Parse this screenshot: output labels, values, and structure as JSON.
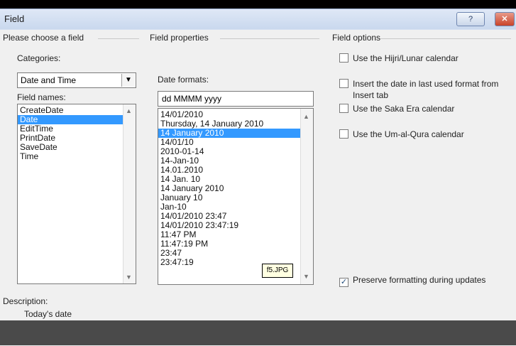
{
  "window": {
    "title": "Field",
    "help_btn": "?",
    "close_btn": "✕"
  },
  "choose": {
    "group_title": "Please choose a field",
    "categories_label": "Categories:",
    "categories_value": "Date and Time",
    "field_names_label": "Field names:",
    "field_names": [
      "CreateDate",
      "Date",
      "EditTime",
      "PrintDate",
      "SaveDate",
      "Time"
    ],
    "selected_field": "Date"
  },
  "properties": {
    "group_title": "Field properties",
    "date_formats_label": "Date formats:",
    "date_format_value": "dd MMMM yyyy",
    "date_formats": [
      "14/01/2010",
      "Thursday, 14 January 2010",
      "14 January 2010",
      "14/01/10",
      "2010-01-14",
      "14-Jan-10",
      "14.01.2010",
      "14 Jan. 10",
      "14 January 2010",
      "January 10",
      "Jan-10",
      "14/01/2010 23:47",
      "14/01/2010 23:47:19",
      "11:47 PM",
      "11:47:19 PM",
      "23:47",
      "23:47:19"
    ],
    "selected_format_index": 2
  },
  "options": {
    "group_title": "Field options",
    "hijri": "Use the Hijri/Lunar calendar",
    "last_used_line1": "Insert the date in last used format from",
    "last_used_line2": "Insert tab",
    "saka": "Use the Saka Era calendar",
    "umalqura": "Use the Um-al-Qura calendar",
    "preserve": "Preserve formatting during updates"
  },
  "tooltip": "f5.JPG",
  "description": {
    "label": "Description:",
    "text": "Today's date"
  }
}
